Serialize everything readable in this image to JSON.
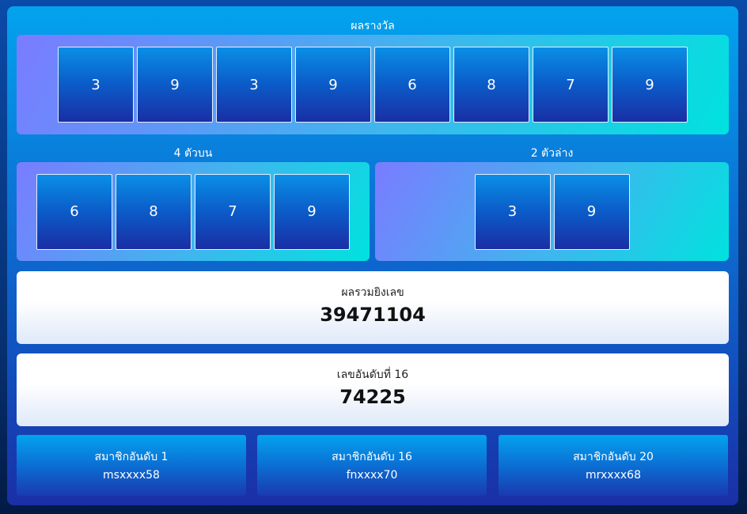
{
  "prize": {
    "title": "ผลรางวัล",
    "digits": [
      "3",
      "9",
      "3",
      "9",
      "6",
      "8",
      "7",
      "9"
    ]
  },
  "top4": {
    "title": "4 ตัวบน",
    "digits": [
      "6",
      "8",
      "7",
      "9"
    ]
  },
  "bottom2": {
    "title": "2 ตัวล่าง",
    "digits": [
      "3",
      "9"
    ]
  },
  "sum": {
    "label": "ผลรวมยิงเลข",
    "value": "39471104"
  },
  "rank16": {
    "label": "เลขอันดับที่ 16",
    "value": "74225"
  },
  "members": [
    {
      "label": "สมาชิกอันดับ 1",
      "value": "msxxxx58"
    },
    {
      "label": "สมาชิกอันดับ 16",
      "value": "fnxxxx70"
    },
    {
      "label": "สมาชิกอันดับ 20",
      "value": "mrxxxx68"
    }
  ]
}
